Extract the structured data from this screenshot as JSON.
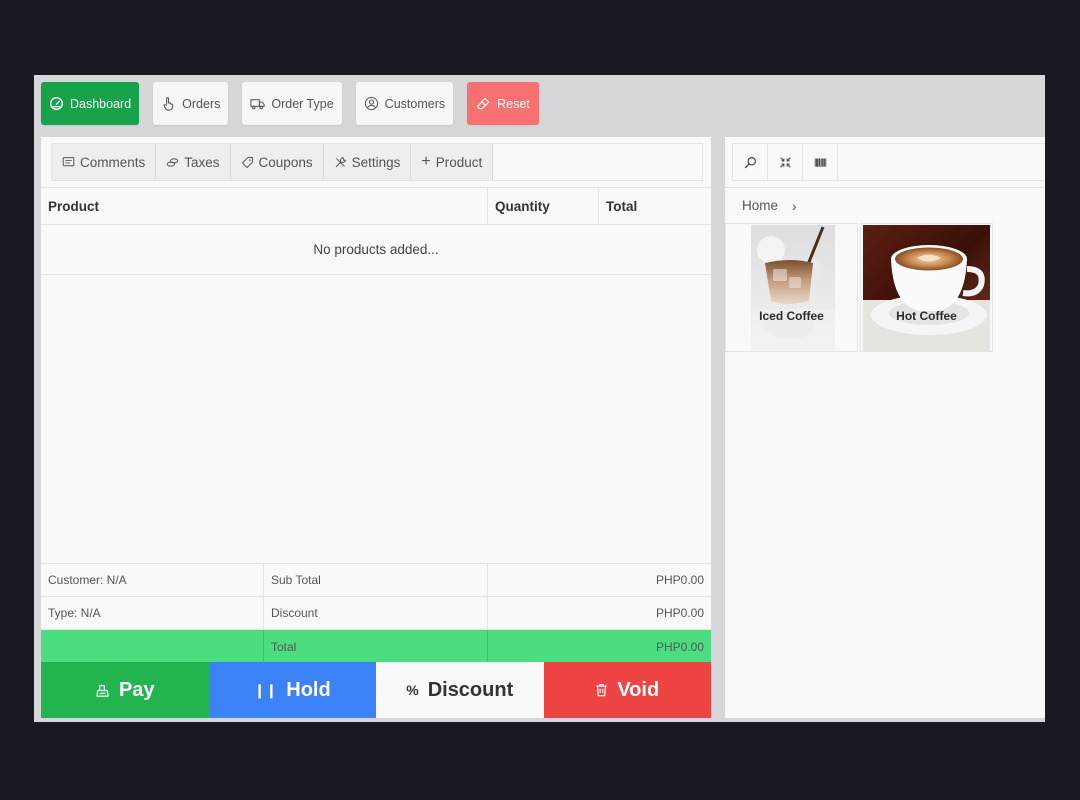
{
  "toolbar": {
    "dashboard": "Dashboard",
    "orders": "Orders",
    "order_type": "Order Type",
    "customers": "Customers",
    "reset": "Reset"
  },
  "cart": {
    "tabs": [
      "Comments",
      "Taxes",
      "Coupons",
      "Settings",
      "Product"
    ],
    "columns": {
      "product": "Product",
      "quantity": "Quantity",
      "total": "Total"
    },
    "empty_message": "No products added...",
    "summary": {
      "customer": "Customer: N/A",
      "type": "Type: N/A",
      "subtotal_label": "Sub Total",
      "subtotal_value": "PHP0.00",
      "discount_label": "Discount",
      "discount_value": "PHP0.00",
      "total_label": "Total",
      "total_value": "PHP0.00"
    },
    "actions": {
      "pay": "Pay",
      "hold": "Hold",
      "discount": "Discount",
      "void": "Void"
    }
  },
  "catalog": {
    "breadcrumb": "Home",
    "products": [
      {
        "name": "Iced Coffee"
      },
      {
        "name": "Hot Coffee"
      }
    ]
  },
  "colors": {
    "dashboard_green": "#16a34a",
    "reset_red": "#f87171",
    "pay_green": "#22b44f",
    "hold_blue": "#3b82f6",
    "void_red": "#ef4444",
    "total_row_green": "#4ade80"
  },
  "icons": {
    "dashboard": "gauge-icon",
    "orders": "hand-pointer-icon",
    "order_type": "truck-icon",
    "customers": "user-circle-icon",
    "reset": "eraser-icon"
  }
}
